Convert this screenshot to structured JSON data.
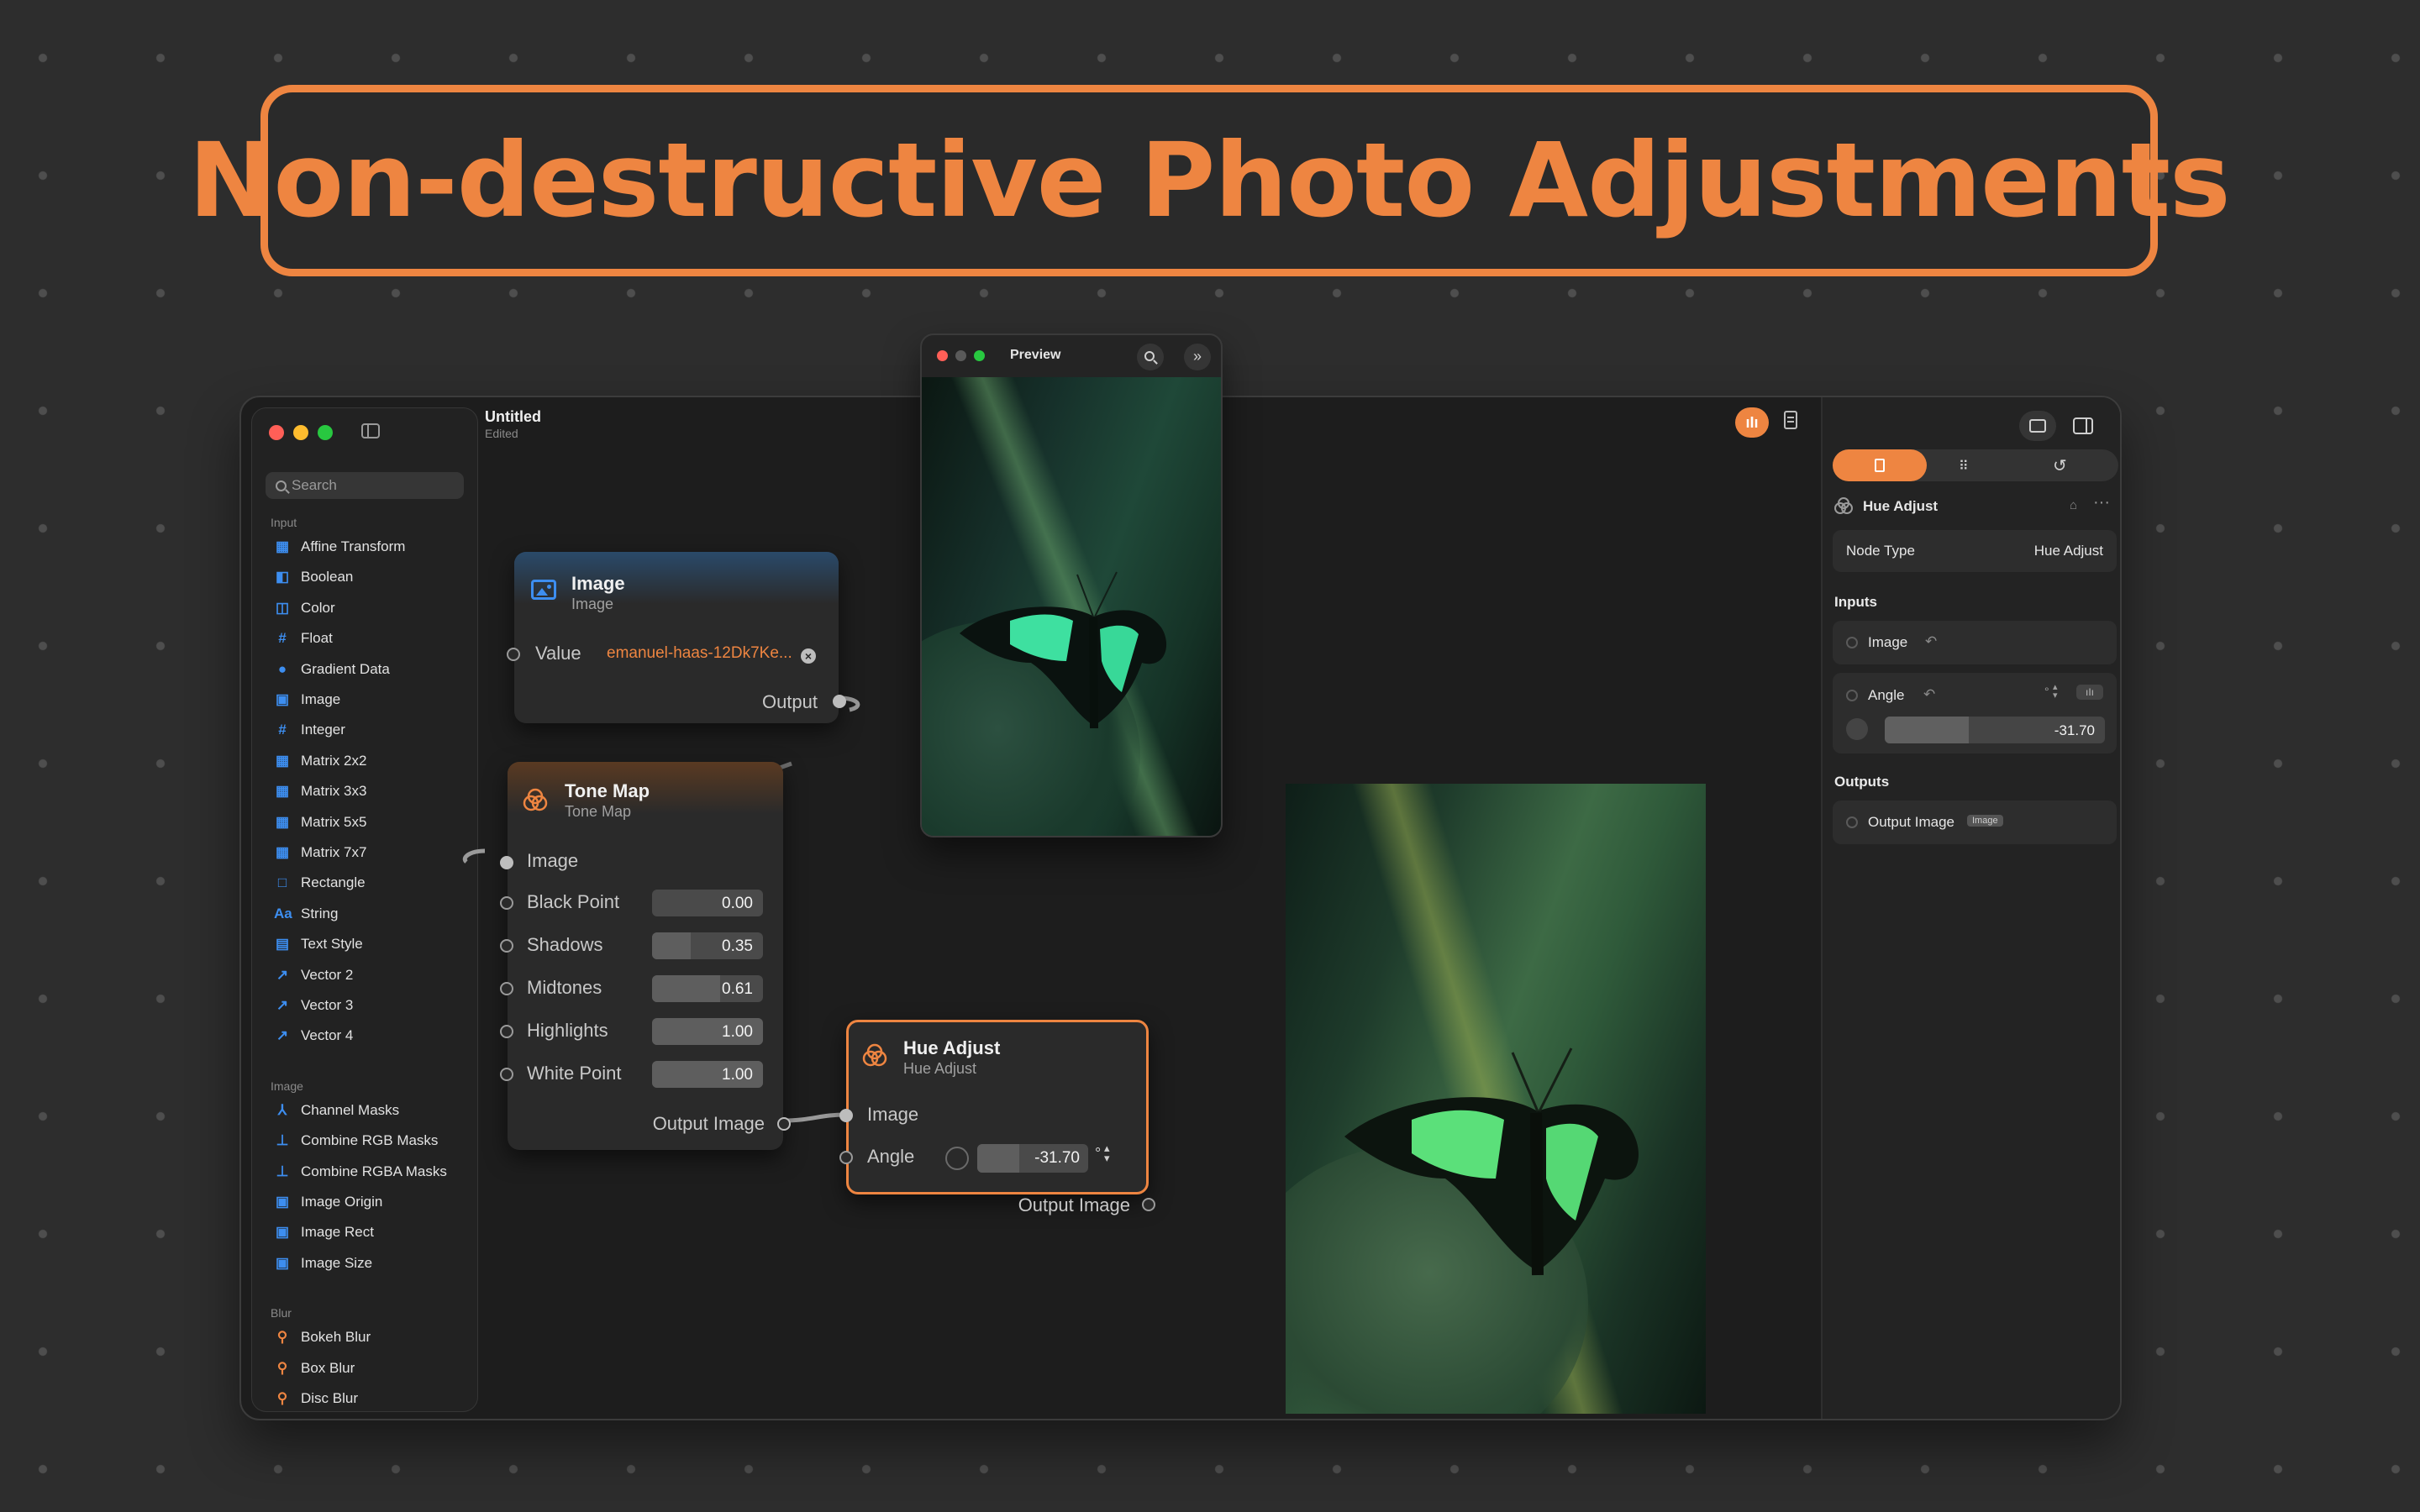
{
  "banner": {
    "title": "Non-destructive Photo Adjustments"
  },
  "colors": {
    "accent": "#ee8541",
    "blue": "#3d8ef0",
    "background": "#2d2d2d"
  },
  "toolbar": {
    "title": "Untitled",
    "subtitle": "Edited"
  },
  "sidebar": {
    "search_placeholder": "Search",
    "sections": [
      {
        "label": "Input",
        "items": [
          {
            "label": "Affine Transform",
            "icon": "grid-icon"
          },
          {
            "label": "Boolean",
            "icon": "toggle-icon"
          },
          {
            "label": "Color",
            "icon": "palette-icon"
          },
          {
            "label": "Float",
            "icon": "hash-icon"
          },
          {
            "label": "Gradient Data",
            "icon": "gradient-icon"
          },
          {
            "label": "Image",
            "icon": "image-icon"
          },
          {
            "label": "Integer",
            "icon": "hash-icon"
          },
          {
            "label": "Matrix 2x2",
            "icon": "matrix-icon"
          },
          {
            "label": "Matrix 3x3",
            "icon": "matrix-icon"
          },
          {
            "label": "Matrix 5x5",
            "icon": "matrix-icon"
          },
          {
            "label": "Matrix 7x7",
            "icon": "matrix-icon"
          },
          {
            "label": "Rectangle",
            "icon": "rectangle-icon"
          },
          {
            "label": "String",
            "icon": "text-icon"
          },
          {
            "label": "Text Style",
            "icon": "document-icon"
          },
          {
            "label": "Vector 2",
            "icon": "arrow-icon"
          },
          {
            "label": "Vector 3",
            "icon": "arrow-icon"
          },
          {
            "label": "Vector 4",
            "icon": "arrow-icon"
          }
        ]
      },
      {
        "label": "Image",
        "items": [
          {
            "label": "Channel Masks",
            "icon": "split-icon"
          },
          {
            "label": "Combine RGB Masks",
            "icon": "merge-icon"
          },
          {
            "label": "Combine RGBA Masks",
            "icon": "merge-icon"
          },
          {
            "label": "Image Origin",
            "icon": "image-icon"
          },
          {
            "label": "Image Rect",
            "icon": "image-icon"
          },
          {
            "label": "Image Size",
            "icon": "image-icon"
          }
        ]
      },
      {
        "label": "Blur",
        "items": [
          {
            "label": "Bokeh Blur",
            "icon": "filter-icon"
          },
          {
            "label": "Box Blur",
            "icon": "filter-icon"
          },
          {
            "label": "Disc Blur",
            "icon": "filter-icon"
          }
        ]
      }
    ]
  },
  "preview": {
    "title": "Preview"
  },
  "nodes": {
    "image": {
      "title": "Image",
      "subtitle": "Image",
      "value_label": "Value",
      "value": "emanuel-haas-12Dk7Ke...",
      "output_label": "Output"
    },
    "tone_map": {
      "title": "Tone Map",
      "subtitle": "Tone Map",
      "image_label": "Image",
      "params": [
        {
          "label": "Black Point",
          "value": "0.00",
          "fraction": 0.0
        },
        {
          "label": "Shadows",
          "value": "0.35",
          "fraction": 0.35
        },
        {
          "label": "Midtones",
          "value": "0.61",
          "fraction": 0.61
        },
        {
          "label": "Highlights",
          "value": "1.00",
          "fraction": 1.0
        },
        {
          "label": "White Point",
          "value": "1.00",
          "fraction": 1.0
        }
      ],
      "output_label": "Output Image"
    },
    "hue_adjust": {
      "title": "Hue Adjust",
      "subtitle": "Hue Adjust",
      "image_label": "Image",
      "angle_label": "Angle",
      "angle_value": "-31.70",
      "unit": "°",
      "output_label": "Output Image"
    }
  },
  "inspector": {
    "node_name": "Hue Adjust",
    "node_type_label": "Node Type",
    "node_type_value": "Hue Adjust",
    "inputs_heading": "Inputs",
    "image_input": "Image",
    "angle_label": "Angle",
    "angle_unit": "°",
    "angle_value": "-31.70",
    "outputs_heading": "Outputs",
    "output_label": "Output Image",
    "output_badge": "Image"
  }
}
